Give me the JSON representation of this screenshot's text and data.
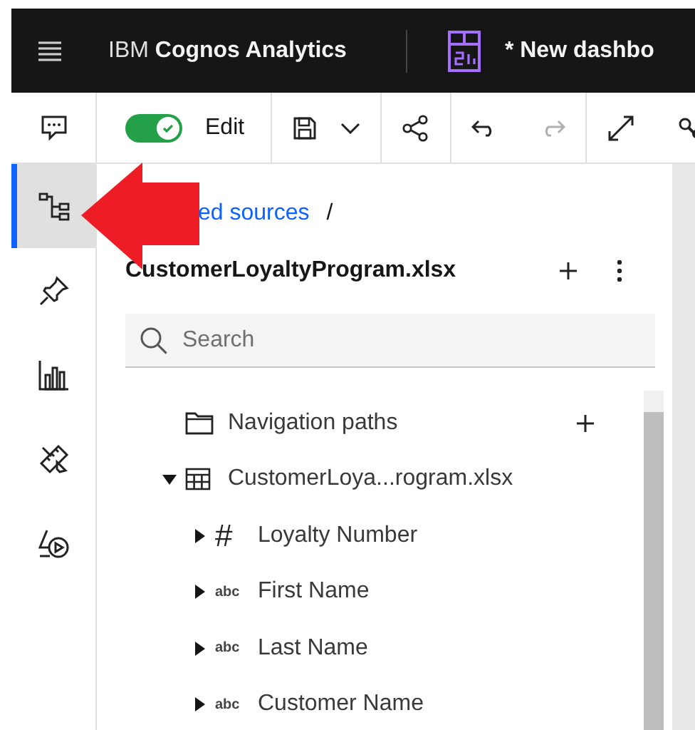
{
  "header": {
    "product": "IBM **Cognos Analytics**",
    "dashboard_title": "* New dashbo"
  },
  "toolbar": {
    "edit_toggle": {
      "label": "Edit",
      "on": true
    },
    "redo_disabled": true
  },
  "sidebar": {
    "items": [
      {
        "kind": "data-tree",
        "selected": true
      },
      {
        "kind": "pin",
        "selected": false
      },
      {
        "kind": "chart",
        "selected": false
      },
      {
        "kind": "tools",
        "selected": false
      },
      {
        "kind": "shapes",
        "selected": false
      }
    ]
  },
  "breadcrumb": {
    "link": "ed sources",
    "separator": "/"
  },
  "source": {
    "title": "CustomerLoyaltyProgram.xlsx"
  },
  "search": {
    "placeholder": "Search"
  },
  "tree": [
    {
      "kind": "folder",
      "label": "Navigation paths",
      "addable": true
    },
    {
      "kind": "table",
      "label": "CustomerLoya...rogram.xlsx",
      "expanded": true,
      "children": [
        {
          "kind": "number",
          "badge": "#",
          "label": "Loyalty Number",
          "expanded": false
        },
        {
          "kind": "text",
          "badge": "abc",
          "label": "First Name",
          "expanded": false
        },
        {
          "kind": "text",
          "badge": "abc",
          "label": "Last Name",
          "expanded": false
        },
        {
          "kind": "text",
          "badge": "abc",
          "label": "Customer Name",
          "expanded": false
        }
      ]
    }
  ]
}
